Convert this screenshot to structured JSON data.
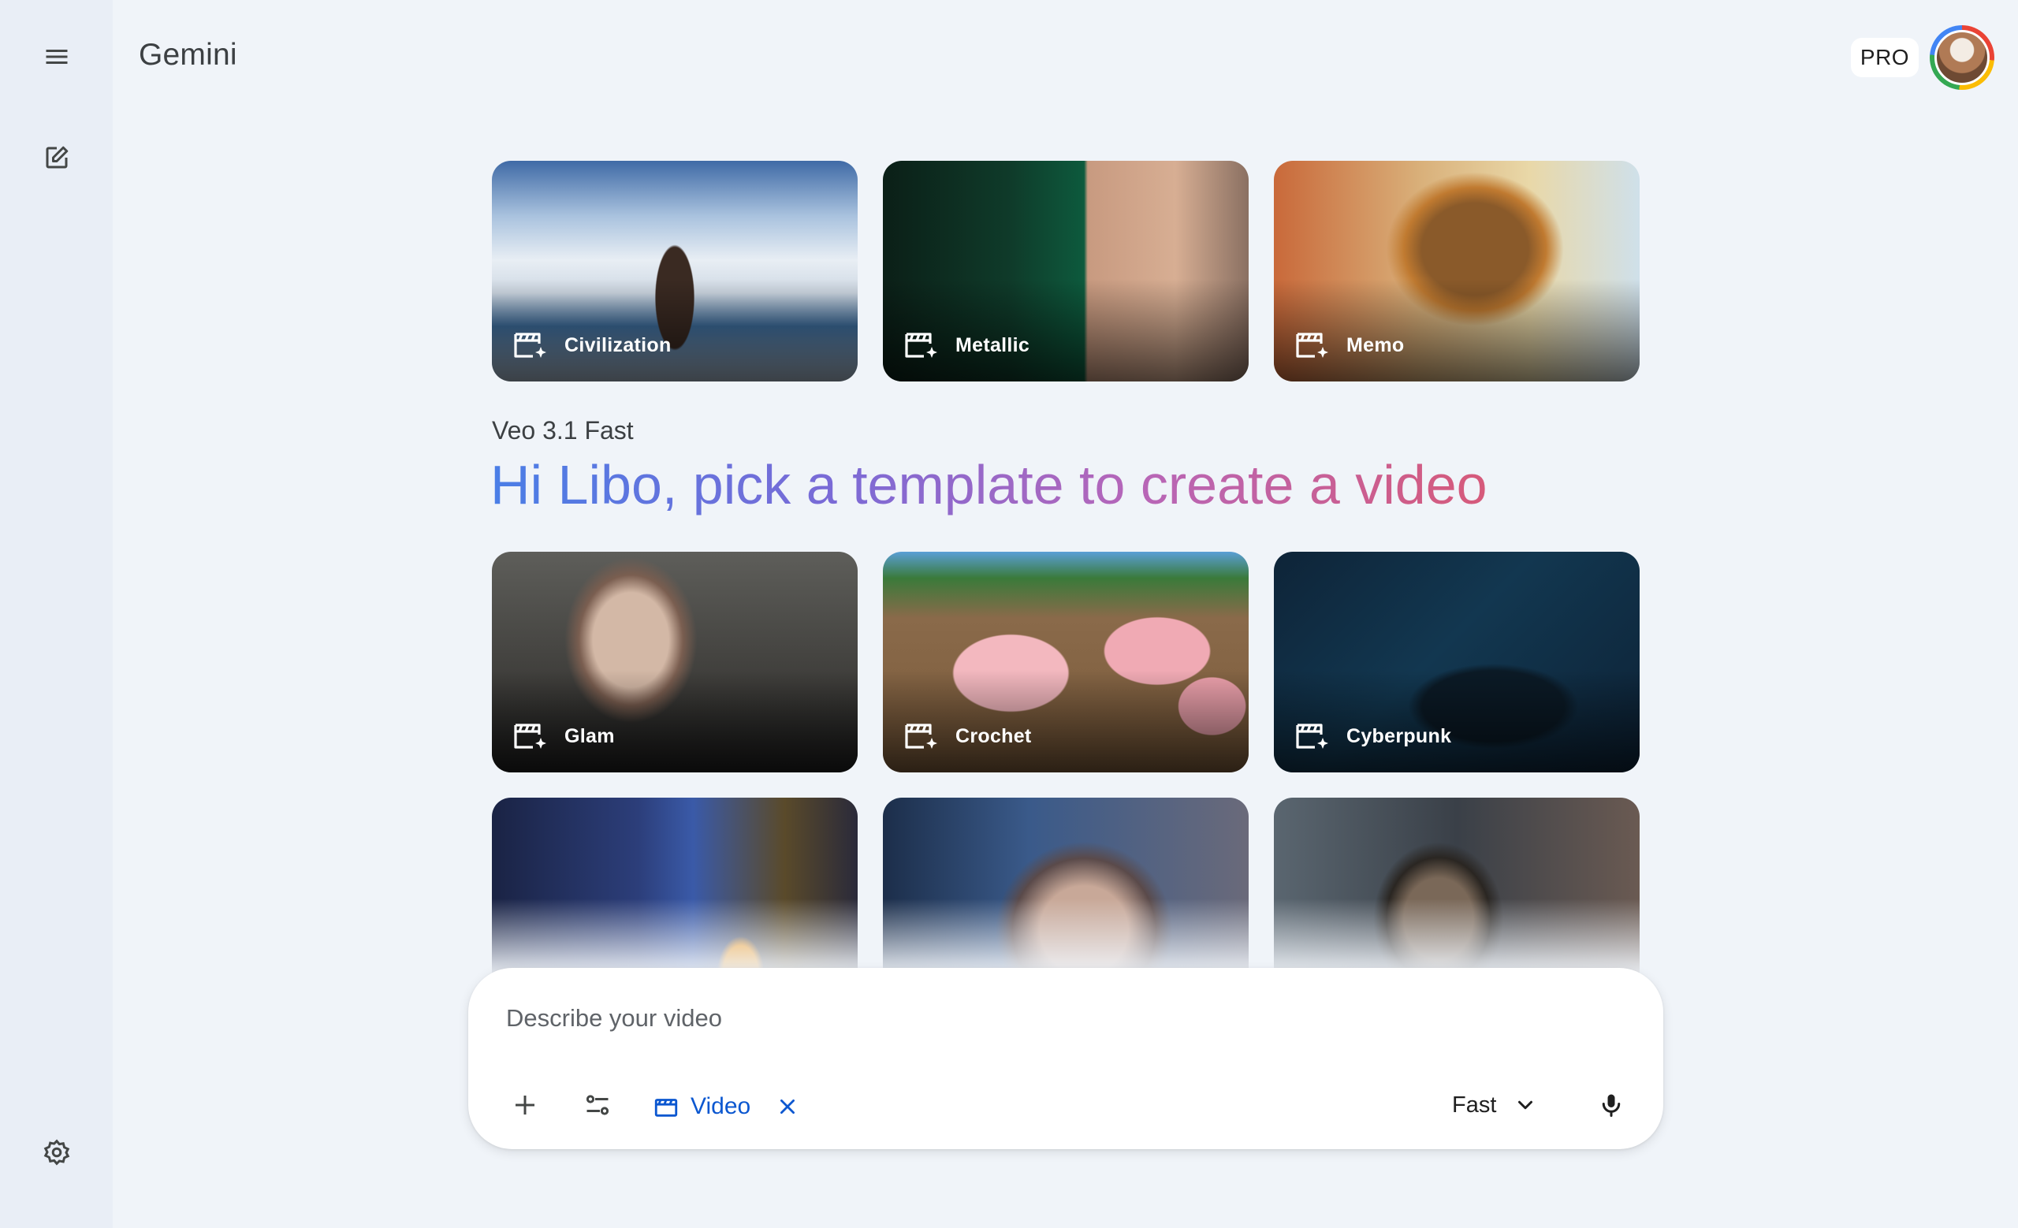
{
  "app": {
    "brand": "Gemini",
    "plan_badge": "PRO"
  },
  "sidebar": {
    "icons": [
      "menu-icon",
      "new-chat-icon",
      "settings-icon"
    ]
  },
  "templates": {
    "top_row": [
      {
        "label": "Civilization"
      },
      {
        "label": "Metallic"
      },
      {
        "label": "Memo"
      }
    ],
    "second_row": [
      {
        "label": "Glam"
      },
      {
        "label": "Crochet"
      },
      {
        "label": "Cyberpunk"
      }
    ]
  },
  "header": {
    "model": "Veo 3.1 Fast",
    "greeting": "Hi Libo, pick a template to create a video"
  },
  "composer": {
    "placeholder": "Describe your video",
    "tool_chip": "Video",
    "mode": "Fast"
  },
  "colors": {
    "background": "#f0f4f9",
    "sidebar": "#e9eef6",
    "accent": "#0b57d0",
    "gradient": [
      "#4a7ee6",
      "#7b6ad6",
      "#b766b8",
      "#d65a7a"
    ]
  }
}
